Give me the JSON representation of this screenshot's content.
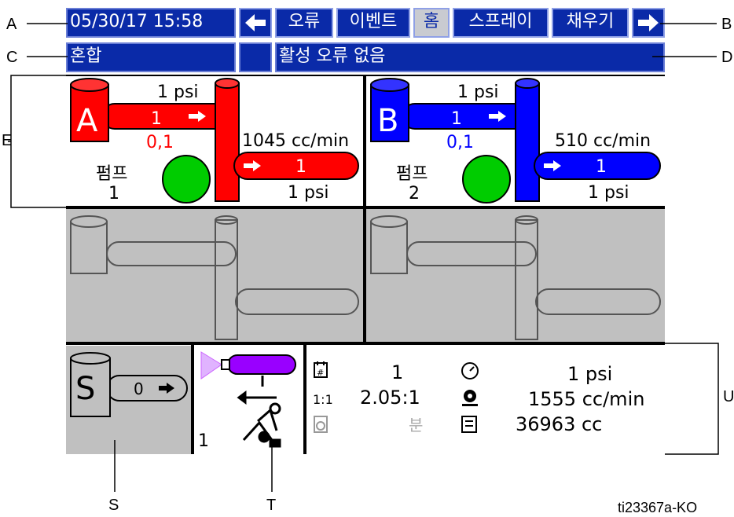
{
  "callouts": {
    "a": "A",
    "b": "B",
    "c": "C",
    "d": "D",
    "e": "E",
    "s": "S",
    "t": "T",
    "u": "U",
    "figure_id": "ti23367a-KO"
  },
  "header": {
    "datetime": "05/30/17 15:58",
    "tabs": [
      "오류",
      "이벤트",
      "홈",
      "스프레이",
      "채우기"
    ],
    "active_tab": "홈"
  },
  "status": {
    "mode": "혼합",
    "message": "활성 오류 없음"
  },
  "pump_a": {
    "letter": "A",
    "inlet_pressure": "1 psi",
    "inlet_flow": "1",
    "ratio": "0,1",
    "flow_rate": "1045 cc/min",
    "outlet_flow": "1",
    "outlet_pressure": "1 psi",
    "pump_label": "펌프",
    "pump_number": "1",
    "color": "#ff0000"
  },
  "pump_b": {
    "letter": "B",
    "inlet_pressure": "1 psi",
    "inlet_flow": "1",
    "ratio": "0,1",
    "flow_rate": "510 cc/min",
    "outlet_flow": "1",
    "outlet_pressure": "1 psi",
    "pump_label": "펌프",
    "pump_number": "2",
    "color": "#0000ff"
  },
  "solvent": {
    "letter": "S",
    "flow": "0"
  },
  "gun": {
    "number": "1"
  },
  "summary": {
    "recipe": "1",
    "ratio_icon": "1:1",
    "ratio": "2.05:1",
    "pot_life": "분",
    "pressure": "1 psi",
    "flow_rate": "1555 cc/min",
    "total": "36963 cc"
  },
  "colors": {
    "screen_blue": "#0a2aa8",
    "indicator_green": "#00cc00",
    "panel_gray": "#c0c0c0",
    "gun_purple": "#9900ff"
  }
}
